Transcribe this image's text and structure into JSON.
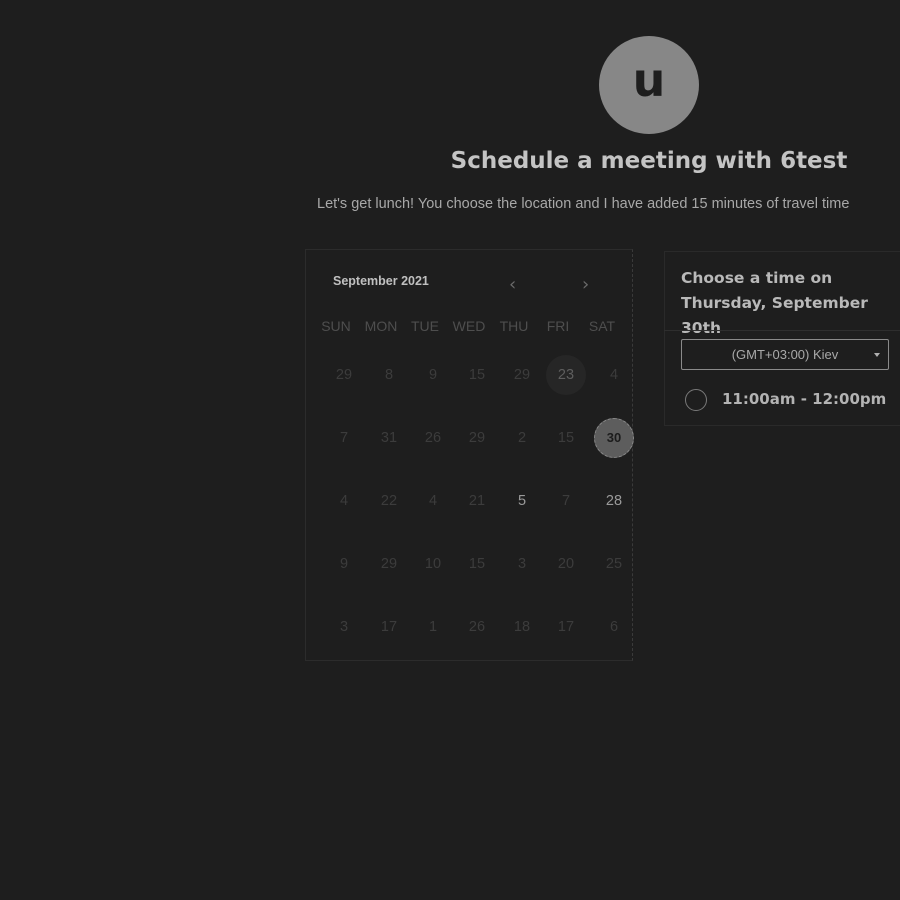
{
  "header": {
    "avatar_letter": "u",
    "title": "Schedule a meeting with 6test",
    "subtitle": "Let's get lunch! You choose the location and I have added 15 minutes of travel time"
  },
  "calendar": {
    "month_label": "September 2021",
    "prev_icon": "chevron-left-icon",
    "next_icon": "chevron-right-icon",
    "weekdays": [
      "SUN",
      "MON",
      "TUE",
      "WED",
      "THU",
      "FRI",
      "SAT"
    ],
    "weeks": [
      [
        "29",
        "8",
        "9",
        "15",
        "29",
        "23",
        "4"
      ],
      [
        "7",
        "31",
        "26",
        "29",
        "2",
        "15",
        "30"
      ],
      [
        "4",
        "22",
        "4",
        "21",
        "5",
        "7",
        "28"
      ],
      [
        "9",
        "29",
        "10",
        "15",
        "3",
        "20",
        "25"
      ],
      [
        "3",
        "17",
        "1",
        "26",
        "18",
        "17",
        "6"
      ]
    ],
    "available": [
      [
        2,
        4
      ],
      [
        2,
        6
      ]
    ],
    "highlighted": [
      [
        0,
        5
      ]
    ],
    "selected": [
      1,
      6
    ]
  },
  "panel": {
    "heading": "Choose a time on Thursday, September 30th",
    "timezone": "(GMT+03:00) Kiev",
    "slots": [
      "11:00am - 12:00pm"
    ]
  }
}
